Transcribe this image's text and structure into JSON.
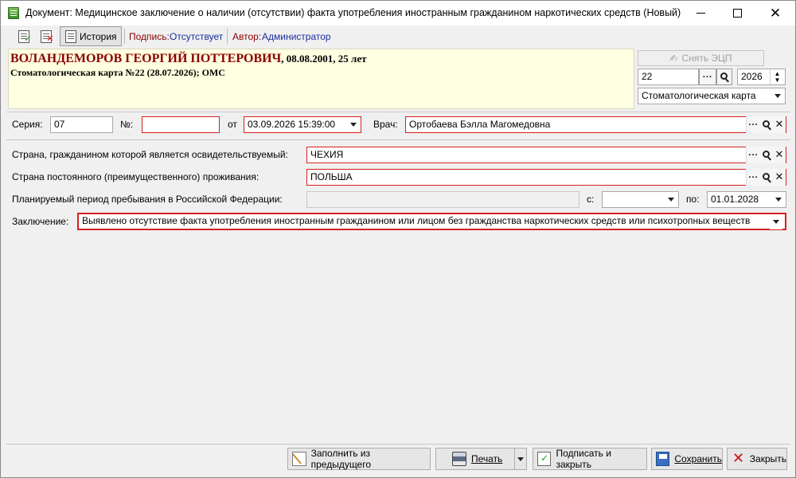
{
  "window": {
    "title": "Документ: Медицинское заключение о наличии (отсутствии) факта употребления иностранным гражданином наркотических средств (Новый)"
  },
  "toolbar": {
    "history_label": "История",
    "signature_label": "Подпись:",
    "signature_value": "Отсутствует",
    "author_label": "Автор:",
    "author_value": "Администратор"
  },
  "patient": {
    "name": "ВОЛАНДЕМОРОВ ГЕОРГИЙ ПОТТЕРОВИЧ",
    "details": ", 08.08.2001, 25 лет",
    "card": "Стоматологическая карта №22 (28.07.2026); ОМС"
  },
  "side": {
    "ecp_button": "Снять ЭЦП",
    "card_number": "22",
    "lookup_dots": "...",
    "year": "2026",
    "card_type": "Стоматологическая карта"
  },
  "form": {
    "series_label": "Серия:",
    "series_value": "07",
    "number_label": "№:",
    "number_value": "",
    "from_label": "от",
    "from_value": "03.09.2026 15:39:00",
    "doctor_label": "Врач:",
    "doctor_value": "Ортобаева Бэлла Магомедовна",
    "citizenship_label": "Страна, гражданином которой является освидетельствуемый:",
    "citizenship_value": "ЧЕХИЯ",
    "residence_label": "Страна постоянного (преимущественного) проживания:",
    "residence_value": "ПОЛЬША",
    "period_label": "Планируемый период пребывания в Российской Федерации:",
    "period_value": "",
    "period_from_label": "с:",
    "period_from_value": "",
    "period_to_label": "по:",
    "period_to_value": "01.01.2028",
    "conclusion_label": "Заключение:",
    "conclusion_value": "Выявлено отсутствие факта употребления иностранным гражданином или лицом без гражданства наркотических средств или психотропных веществ"
  },
  "buttons": {
    "fill_prev": "Заполнить из предыдущего",
    "print": "Печать",
    "sign_close": "Подписать и закрыть",
    "save": "Сохранить",
    "close": "Закрыть"
  }
}
